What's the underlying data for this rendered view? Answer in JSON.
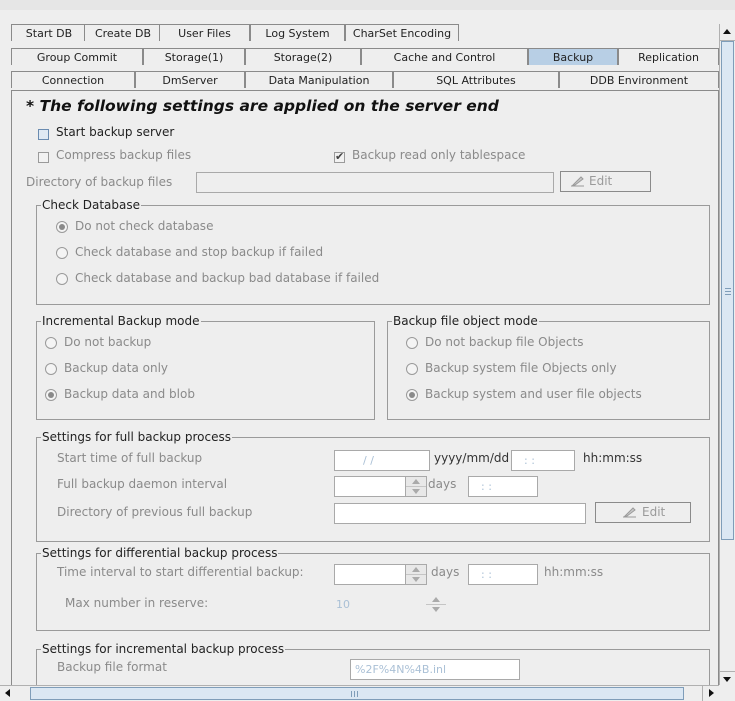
{
  "tabs": {
    "row1": [
      "Start DB",
      "Create DB",
      "User Files",
      "Log System",
      "CharSet Encoding"
    ],
    "row2": [
      "Group Commit",
      "Storage(1)",
      "Storage(2)",
      "Cache and Control",
      "Backup",
      "Replication"
    ],
    "row3": [
      "Connection",
      "DmServer",
      "Data Manipulation",
      "SQL Attributes",
      "DDB Environment"
    ],
    "active": "Backup"
  },
  "panel": {
    "heading": "* The following settings are applied on the server end",
    "start_backup_server": "Start backup server",
    "start_backup_server_checked": false,
    "compress_backup_files": "Compress backup files",
    "compress_backup_files_checked": false,
    "backup_read_only_tablespace": "Backup read only tablespace",
    "backup_read_only_tablespace_checked": true,
    "directory_label": "Directory of backup files",
    "directory_value": "",
    "edit_button": "Edit"
  },
  "check_database": {
    "title": "Check Database",
    "options": [
      "Do not check database",
      "Check database and stop backup if failed",
      "Check database and backup bad database if failed"
    ],
    "selected": 0
  },
  "incremental_mode": {
    "title": "Incremental Backup mode",
    "options": [
      "Do not backup",
      "Backup data only",
      "Backup data and blob"
    ],
    "selected": 2
  },
  "file_object_mode": {
    "title": "Backup file object mode",
    "options": [
      "Do not backup file Objects",
      "Backup system file Objects only",
      "Backup system and user file objects"
    ],
    "selected": 2
  },
  "full_backup": {
    "title": "Settings for full backup process",
    "start_time_label": "Start time of full backup",
    "date_value": "  /  /",
    "date_format": "yyyy/mm/dd",
    "time_value": "  :   :",
    "time_format": "hh:mm:ss",
    "daemon_label": "Full backup daemon interval",
    "daemon_value": "",
    "days_label": "days",
    "daemon_time": "  :   :",
    "prev_dir_label": "Directory of previous full backup",
    "prev_dir_value": "",
    "edit_button": "Edit"
  },
  "differential_backup": {
    "title": "Settings for differential backup process",
    "interval_label": "Time interval to start differential backup:",
    "interval_value": "",
    "days_label": "days",
    "time_value": "  :   :",
    "time_format": "hh:mm:ss",
    "max_label": "Max number in reserve:",
    "max_value": "10"
  },
  "incremental_backup": {
    "title": "Settings for incremental backup process",
    "format_label": "Backup file format",
    "format_value": "%2F%4N%4B.inl"
  }
}
